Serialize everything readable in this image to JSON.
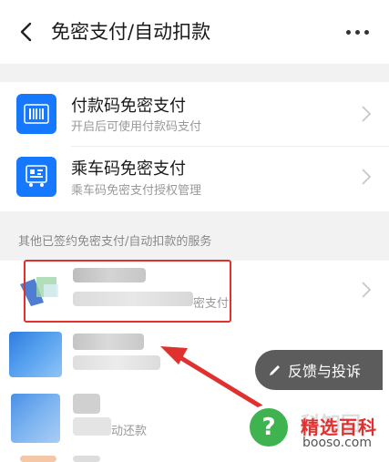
{
  "header": {
    "title": "免密支付/自动扣款"
  },
  "rows": [
    {
      "title": "付款码免密支付",
      "subtitle": "开启后可使用付款码支付",
      "icon": "barcode-icon"
    },
    {
      "title": "乘车码免密支付",
      "subtitle": "乘车码免密支付授权管理",
      "icon": "bus-code-icon"
    }
  ],
  "section_label": "其他已签约免密支付/自动扣款的服务",
  "services": [
    {
      "subtitle_fragment": "密支付"
    },
    {
      "subtitle_fragment": ""
    },
    {
      "subtitle_fragment": "动还款"
    }
  ],
  "feedback": {
    "label": "反馈与投诉"
  },
  "watermark": {
    "logo_char": "?",
    "name": "精选百科",
    "url": "booso.com",
    "faint": "科知回"
  },
  "colors": {
    "accent": "#1677ff",
    "highlight": "#e0312f",
    "watermark_green": "#3fb34f"
  }
}
